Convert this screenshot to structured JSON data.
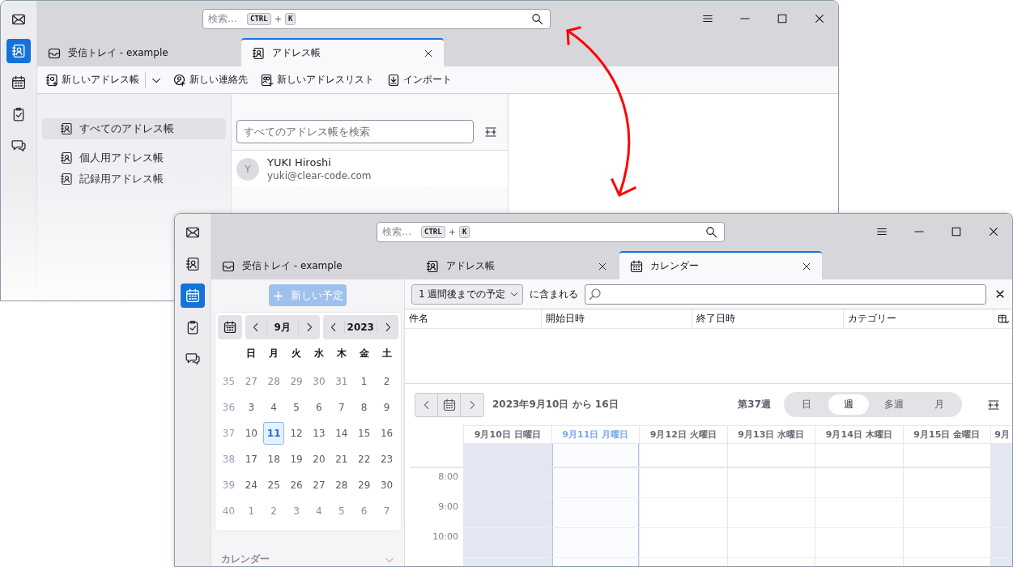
{
  "address_book_window": {
    "search": {
      "placeholder": "検索…",
      "keys": [
        "CTRL",
        "K"
      ],
      "joiner": "+"
    },
    "spaces": [
      {
        "selected": false
      },
      {
        "selected": true
      },
      {
        "selected": false
      },
      {
        "selected": false
      },
      {
        "selected": false
      }
    ],
    "tabs": [
      {
        "label": "受信トレイ - example",
        "selected": false,
        "closable": false
      },
      {
        "label": "アドレス帳",
        "selected": true,
        "closable": true
      }
    ],
    "toolbar": [
      {
        "label": "新しいアドレス帳",
        "menu": true
      },
      {
        "label": "新しい連絡先",
        "menu": false
      },
      {
        "label": "新しいアドレスリスト",
        "menu": false
      },
      {
        "label": "インポート",
        "menu": false
      }
    ],
    "books": [
      {
        "label": "すべてのアドレス帳",
        "selected": true
      },
      {
        "label": "個人用アドレス帳",
        "selected": false
      },
      {
        "label": "記録用アドレス帳",
        "selected": false
      }
    ],
    "contacts_search": {
      "placeholder": "すべてのアドレス帳を検索"
    },
    "contacts": [
      {
        "initial": "Y",
        "name": "YUKI Hiroshi",
        "email": "yuki@clear-code.com"
      }
    ]
  },
  "calendar_window": {
    "search": {
      "placeholder": "検索…",
      "keys": [
        "CTRL",
        "K"
      ],
      "joiner": "+"
    },
    "spaces": [
      {
        "selected": false
      },
      {
        "selected": false
      },
      {
        "selected": true
      },
      {
        "selected": false
      },
      {
        "selected": false
      }
    ],
    "tabs": [
      {
        "label": "受信トレイ - example",
        "selected": false,
        "closable": false
      },
      {
        "label": "アドレス帳",
        "selected": false,
        "closable": true
      },
      {
        "label": "カレンダー",
        "selected": true,
        "closable": true
      }
    ],
    "new_event": {
      "icon": "+",
      "label": "新しい予定",
      "disabled": true
    },
    "minimonth": {
      "month": "9月",
      "year": "2023",
      "weekdays": [
        "日",
        "月",
        "火",
        "水",
        "木",
        "金",
        "土"
      ],
      "weeks": [
        {
          "number": "35",
          "days": [
            {
              "label": "27",
              "other_month": true,
              "selected": false
            },
            {
              "label": "28",
              "other_month": true,
              "selected": false
            },
            {
              "label": "29",
              "other_month": true,
              "selected": false
            },
            {
              "label": "30",
              "other_month": true,
              "selected": false
            },
            {
              "label": "31",
              "other_month": true,
              "selected": false
            },
            {
              "label": "1",
              "other_month": false,
              "selected": false
            },
            {
              "label": "2",
              "other_month": false,
              "selected": false
            }
          ]
        },
        {
          "number": "36",
          "days": [
            {
              "label": "3",
              "other_month": false,
              "selected": false
            },
            {
              "label": "4",
              "other_month": false,
              "selected": false
            },
            {
              "label": "5",
              "other_month": false,
              "selected": false
            },
            {
              "label": "6",
              "other_month": false,
              "selected": false
            },
            {
              "label": "7",
              "other_month": false,
              "selected": false
            },
            {
              "label": "8",
              "other_month": false,
              "selected": false
            },
            {
              "label": "9",
              "other_month": false,
              "selected": false
            }
          ]
        },
        {
          "number": "37",
          "days": [
            {
              "label": "10",
              "other_month": false,
              "selected": false
            },
            {
              "label": "11",
              "other_month": false,
              "selected": true
            },
            {
              "label": "12",
              "other_month": false,
              "selected": false
            },
            {
              "label": "13",
              "other_month": false,
              "selected": false
            },
            {
              "label": "14",
              "other_month": false,
              "selected": false
            },
            {
              "label": "15",
              "other_month": false,
              "selected": false
            },
            {
              "label": "16",
              "other_month": false,
              "selected": false
            }
          ]
        },
        {
          "number": "38",
          "days": [
            {
              "label": "17",
              "other_month": false,
              "selected": false
            },
            {
              "label": "18",
              "other_month": false,
              "selected": false
            },
            {
              "label": "19",
              "other_month": false,
              "selected": false
            },
            {
              "label": "20",
              "other_month": false,
              "selected": false
            },
            {
              "label": "21",
              "other_month": false,
              "selected": false
            },
            {
              "label": "22",
              "other_month": false,
              "selected": false
            },
            {
              "label": "23",
              "other_month": false,
              "selected": false
            }
          ]
        },
        {
          "number": "39",
          "days": [
            {
              "label": "24",
              "other_month": false,
              "selected": false
            },
            {
              "label": "25",
              "other_month": false,
              "selected": false
            },
            {
              "label": "26",
              "other_month": false,
              "selected": false
            },
            {
              "label": "27",
              "other_month": false,
              "selected": false
            },
            {
              "label": "28",
              "other_month": false,
              "selected": false
            },
            {
              "label": "29",
              "other_month": false,
              "selected": false
            },
            {
              "label": "30",
              "other_month": false,
              "selected": false
            }
          ]
        },
        {
          "number": "40",
          "days": [
            {
              "label": "1",
              "other_month": true,
              "selected": false
            },
            {
              "label": "2",
              "other_month": true,
              "selected": false
            },
            {
              "label": "3",
              "other_month": true,
              "selected": false
            },
            {
              "label": "4",
              "other_month": true,
              "selected": false
            },
            {
              "label": "5",
              "other_month": true,
              "selected": false
            },
            {
              "label": "6",
              "other_month": true,
              "selected": false
            },
            {
              "label": "7",
              "other_month": true,
              "selected": false
            }
          ]
        }
      ]
    },
    "calendar_list": {
      "label": "カレンダー"
    },
    "filter": {
      "range": "1 週間後までの予定",
      "label": "に含まれる"
    },
    "columns": [
      "件名",
      "開始日時",
      "終了日時",
      "カテゴリー"
    ],
    "range_label": "2023年9月10日 から 16日",
    "week_label": "第37週",
    "views": [
      {
        "label": "日",
        "selected": false
      },
      {
        "label": "週",
        "selected": true
      },
      {
        "label": "多週",
        "selected": false
      },
      {
        "label": "月",
        "selected": false
      }
    ],
    "days": [
      {
        "label": "9月10日 日曜日",
        "weekend": true,
        "today": false
      },
      {
        "label": "9月11日 月曜日",
        "weekend": false,
        "today": true
      },
      {
        "label": "9月12日 火曜日",
        "weekend": false,
        "today": false
      },
      {
        "label": "9月13日 水曜日",
        "weekend": false,
        "today": false
      },
      {
        "label": "9月14日 木曜日",
        "weekend": false,
        "today": false
      },
      {
        "label": "9月15日 金曜日",
        "weekend": false,
        "today": false
      },
      {
        "label": "9月",
        "weekend": true,
        "today": false
      }
    ],
    "hours": [
      "8:00",
      "9:00",
      "10:00"
    ]
  }
}
